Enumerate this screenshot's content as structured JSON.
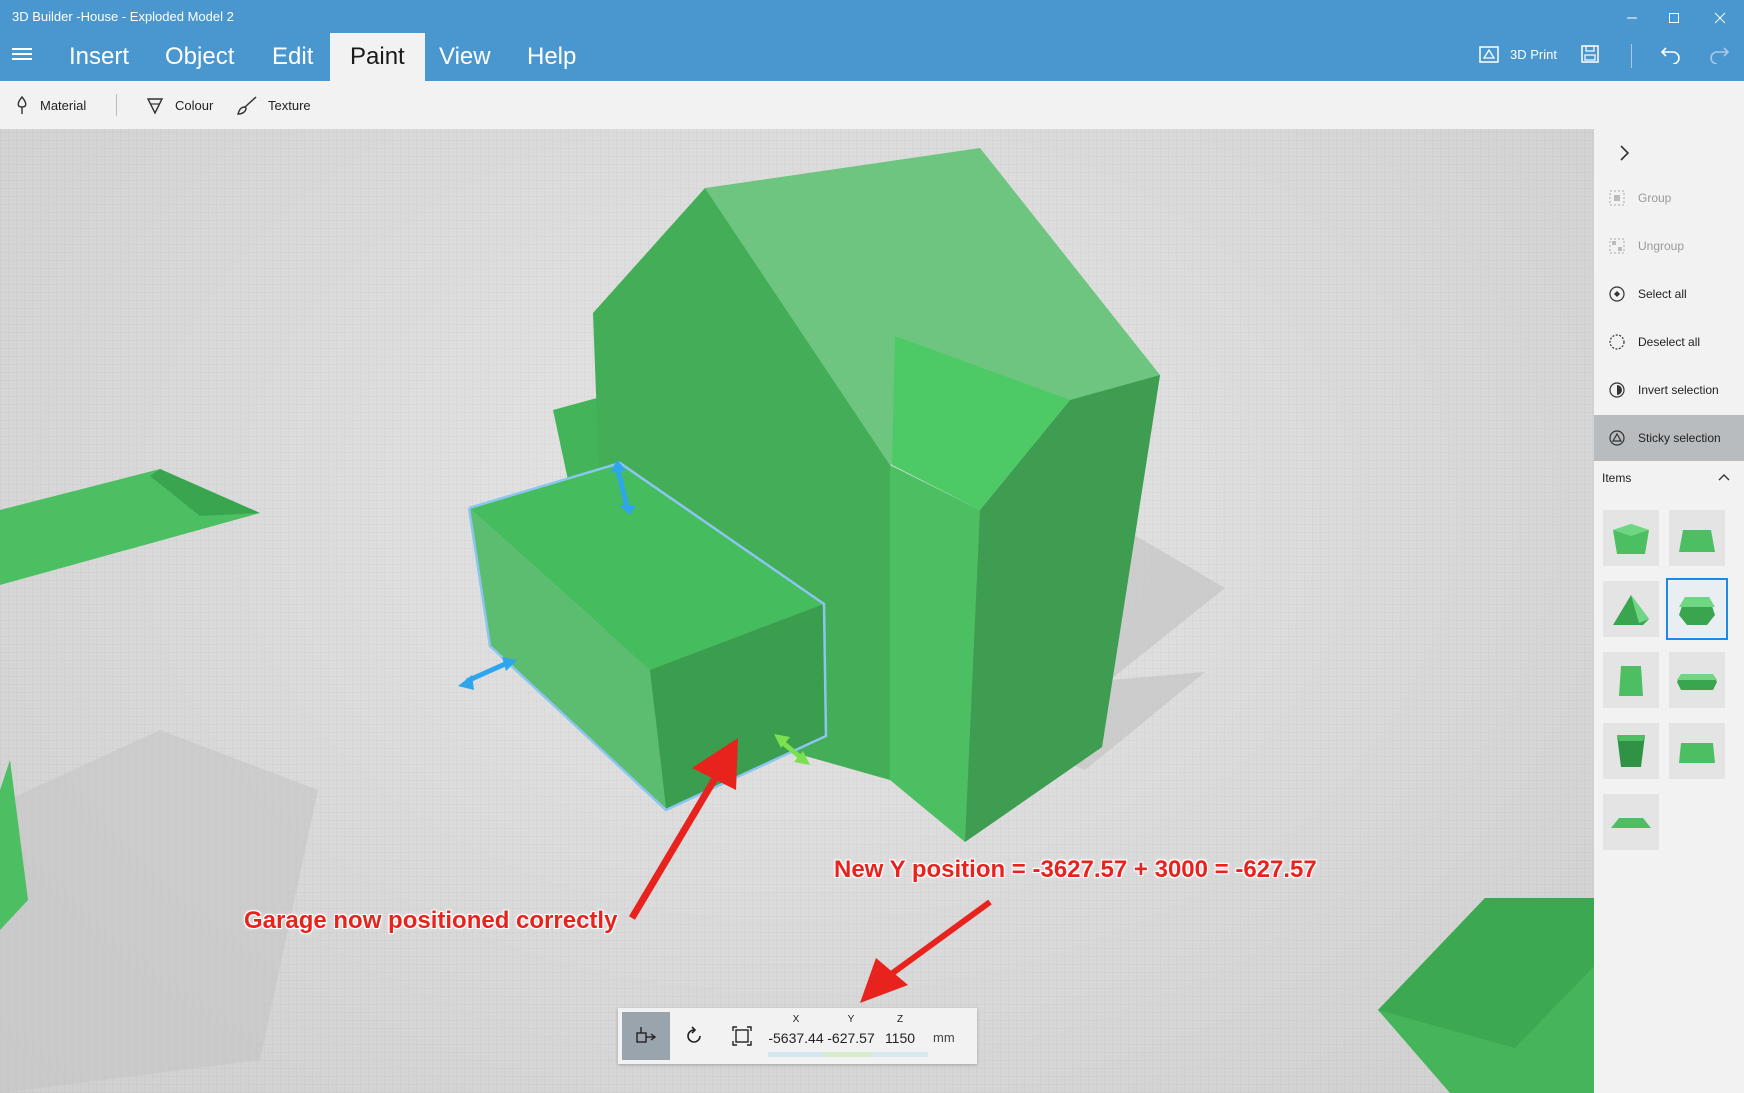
{
  "window": {
    "title": "3D Builder -House - Exploded Model 2",
    "controls": [
      "minimize",
      "maximize",
      "close"
    ]
  },
  "menu": {
    "items": [
      "Insert",
      "Object",
      "Edit",
      "Paint",
      "View",
      "Help"
    ],
    "active": "Paint",
    "print_label": "3D Print"
  },
  "ribbon": {
    "material_label": "Material",
    "colour_label": "Colour",
    "texture_label": "Texture"
  },
  "panel": {
    "group_label": "Group",
    "ungroup_label": "Ungroup",
    "select_all_label": "Select all",
    "deselect_all_label": "Deselect all",
    "invert_selection_label": "Invert selection",
    "sticky_selection_label": "Sticky selection",
    "items_heading": "Items",
    "selected_item_index": 3,
    "item_count": 9
  },
  "transform": {
    "x_label": "X",
    "x_value": "-5637.44",
    "y_label": "Y",
    "y_value": "-627.57",
    "z_label": "Z",
    "z_value": "1150",
    "unit": "mm"
  },
  "annotations": {
    "garage_note": "Garage now positioned correctly",
    "y_position_note": "New Y position = -3627.57 + 3000 = -627.57"
  },
  "colors": {
    "title_bar": "#4a97cf",
    "model_green": "#4cbf62",
    "selection_blue": "#35a9e8",
    "annotation_red": "#e8221c"
  }
}
